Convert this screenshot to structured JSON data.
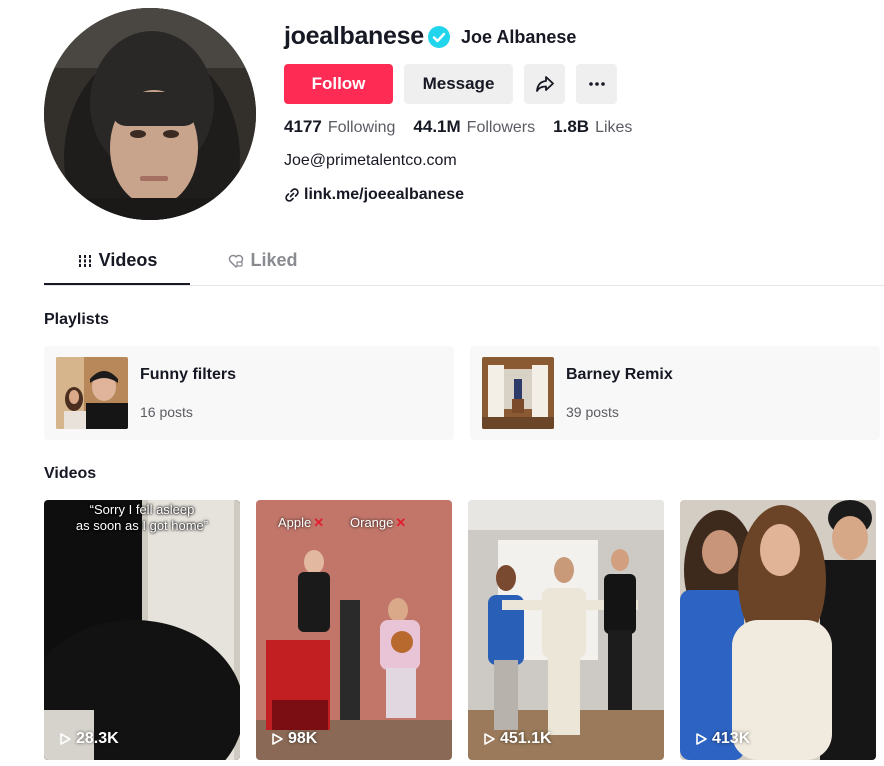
{
  "profile": {
    "username": "joealbanese",
    "nickname": "Joe Albanese",
    "verified_icon": "verified-badge-icon",
    "follow_label": "Follow",
    "message_label": "Message",
    "share_icon": "share-arrow-icon",
    "more_icon": "more-dots-icon",
    "stats": {
      "following_count": "4177",
      "following_label": "Following",
      "followers_count": "44.1M",
      "followers_label": "Followers",
      "likes_count": "1.8B",
      "likes_label": "Likes"
    },
    "bio": "Joe@primetalentco.com",
    "link": "link.me/joeealbanese"
  },
  "tabs": [
    {
      "label": "Videos",
      "icon": "grid-bars-icon",
      "active": true
    },
    {
      "label": "Liked",
      "icon": "heart-lock-icon",
      "active": false
    }
  ],
  "playlists": {
    "title": "Playlists",
    "items": [
      {
        "name": "Funny filters",
        "count": "16 posts"
      },
      {
        "name": "Barney Remix",
        "count": "39 posts"
      }
    ]
  },
  "videos": {
    "title": "Videos",
    "items": [
      {
        "views": "28.3K",
        "caption_line1": "“Sorry I fell asleep",
        "caption_line2": "as soon as I got home”"
      },
      {
        "views": "98K",
        "tag_left": "Apple",
        "tag_right": "Orange"
      },
      {
        "views": "451.1K"
      },
      {
        "views": "413K"
      }
    ]
  },
  "colors": {
    "accent": "#fe2c55",
    "verified": "#20d5ec",
    "text": "#161823",
    "muted": "#5b5c63",
    "button_bg": "#efefef"
  }
}
